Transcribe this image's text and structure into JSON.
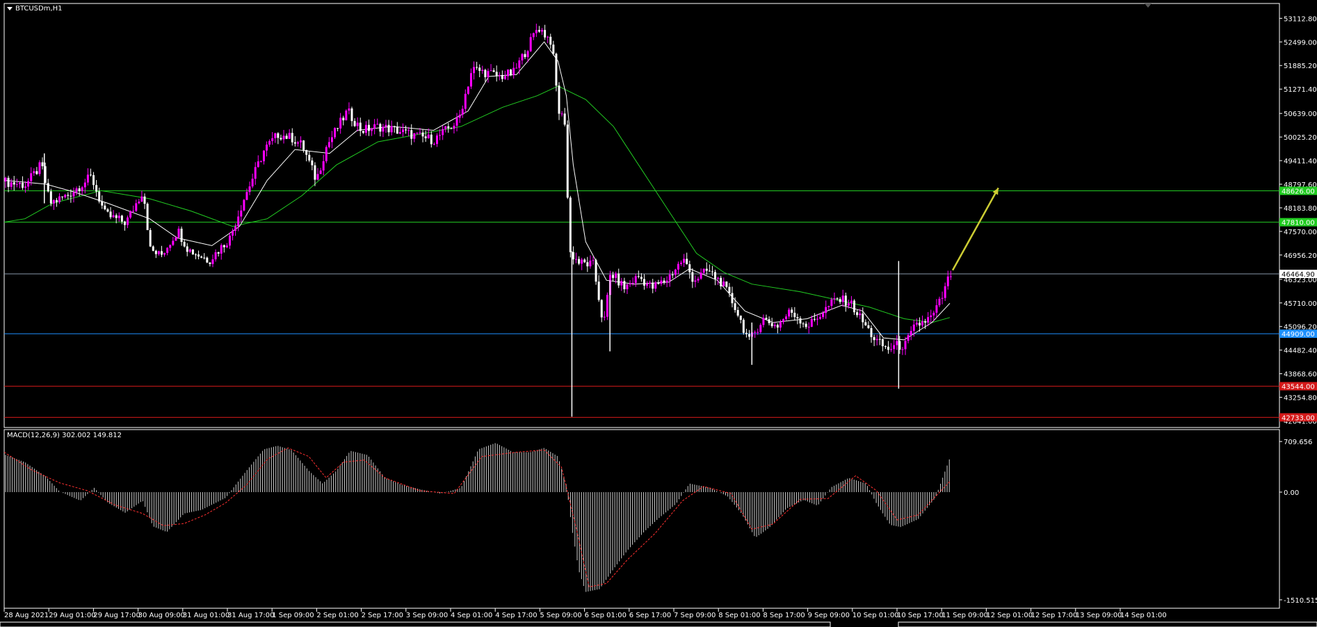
{
  "window": {
    "symbol_title": "BTCUSDm,H1",
    "colors": {
      "background": "#000000",
      "foreground": "#ffffff",
      "bull_candle": "#ff00ff",
      "bear_candle": "#ffffff",
      "ma_fast": "#ffffff",
      "ma_slow": "#22cc22",
      "macd_hist": "#cccccc",
      "macd_signal": "#ff3030",
      "arrow": "#cccc33"
    }
  },
  "chart_data": [
    {
      "type": "candlestick",
      "title": "BTCUSDm,H1",
      "price_ticks": [
        "53112.80",
        "52499.00",
        "51885.20",
        "51271.40",
        "50639.00",
        "50025.20",
        "49411.40",
        "48797.60",
        "48183.80",
        "47570.00",
        "46956.20",
        "46323.00",
        "45710.00",
        "45096.20",
        "44482.40",
        "43868.60",
        "43254.80",
        "42641.00"
      ],
      "ylim": [
        42560,
        53300
      ],
      "xlim": [
        0,
        1376
      ],
      "time_ticks": [
        "28 Aug 2021",
        "29 Aug 01:00",
        "29 Aug 17:00",
        "30 Aug 09:00",
        "31 Aug 01:00",
        "31 Aug 17:00",
        "1 Sep 09:00",
        "2 Sep 01:00",
        "2 Sep 17:00",
        "3 Sep 09:00",
        "4 Sep 01:00",
        "4 Sep 17:00",
        "5 Sep 09:00",
        "6 Sep 01:00",
        "6 Sep 17:00",
        "7 Sep 09:00",
        "8 Sep 01:00",
        "8 Sep 17:00",
        "9 Sep 09:00",
        "10 Sep 01:00",
        "10 Sep 17:00",
        "11 Sep 09:00",
        "12 Sep 01:00",
        "12 Sep 17:00",
        "13 Sep 09:00",
        "14 Sep 01:00"
      ],
      "price_path": [
        [
          0,
          48870
        ],
        [
          35,
          48780
        ],
        [
          58,
          49300
        ],
        [
          70,
          48300
        ],
        [
          95,
          48500
        ],
        [
          130,
          48990
        ],
        [
          150,
          48000
        ],
        [
          180,
          47800
        ],
        [
          205,
          48650
        ],
        [
          215,
          47100
        ],
        [
          230,
          46930
        ],
        [
          255,
          47600
        ],
        [
          270,
          47100
        ],
        [
          300,
          46820
        ],
        [
          330,
          47400
        ],
        [
          350,
          48400
        ],
        [
          380,
          49700
        ],
        [
          400,
          50100
        ],
        [
          420,
          50000
        ],
        [
          435,
          49800
        ],
        [
          455,
          48900
        ],
        [
          470,
          49800
        ],
        [
          500,
          50700
        ],
        [
          520,
          50200
        ],
        [
          545,
          50300
        ],
        [
          570,
          50200
        ],
        [
          600,
          50050
        ],
        [
          625,
          49950
        ],
        [
          660,
          50450
        ],
        [
          680,
          51800
        ],
        [
          700,
          51700
        ],
        [
          720,
          51600
        ],
        [
          740,
          51700
        ],
        [
          760,
          52350
        ],
        [
          775,
          52900
        ],
        [
          795,
          52500
        ],
        [
          805,
          50700
        ],
        [
          815,
          50400
        ],
        [
          820,
          47050
        ],
        [
          835,
          46750
        ],
        [
          855,
          46700
        ],
        [
          870,
          45100
        ],
        [
          880,
          46500
        ],
        [
          900,
          46100
        ],
        [
          920,
          46400
        ],
        [
          940,
          46100
        ],
        [
          960,
          46300
        ],
        [
          985,
          46850
        ],
        [
          1000,
          46300
        ],
        [
          1020,
          46550
        ],
        [
          1040,
          46250
        ],
        [
          1060,
          45600
        ],
        [
          1080,
          44700
        ],
        [
          1100,
          45300
        ],
        [
          1120,
          45100
        ],
        [
          1140,
          45500
        ],
        [
          1165,
          45100
        ],
        [
          1185,
          45450
        ],
        [
          1205,
          45800
        ],
        [
          1225,
          45750
        ],
        [
          1245,
          45200
        ],
        [
          1262,
          44750
        ],
        [
          1280,
          44500
        ],
        [
          1292,
          44600
        ],
        [
          1305,
          44600
        ],
        [
          1320,
          45100
        ],
        [
          1345,
          45350
        ],
        [
          1360,
          45900
        ],
        [
          1370,
          46450
        ]
      ],
      "spikes": [
        {
          "x": 58,
          "high": 49600,
          "low": 48300
        },
        {
          "x": 820,
          "high": 47050,
          "low": 42750
        },
        {
          "x": 875,
          "high": 46300,
          "low": 44450
        },
        {
          "x": 1080,
          "high": 45200,
          "low": 44100
        },
        {
          "x": 1292,
          "high": 46800,
          "low": 43480
        }
      ],
      "ma_fast_path": [
        [
          0,
          48900
        ],
        [
          60,
          48800
        ],
        [
          100,
          48600
        ],
        [
          150,
          48300
        ],
        [
          210,
          47900
        ],
        [
          250,
          47400
        ],
        [
          300,
          47200
        ],
        [
          340,
          47700
        ],
        [
          380,
          48900
        ],
        [
          420,
          49700
        ],
        [
          470,
          49600
        ],
        [
          510,
          50200
        ],
        [
          560,
          50300
        ],
        [
          620,
          50200
        ],
        [
          670,
          50700
        ],
        [
          700,
          51600
        ],
        [
          740,
          51650
        ],
        [
          780,
          52500
        ],
        [
          800,
          52000
        ],
        [
          812,
          51100
        ],
        [
          822,
          49300
        ],
        [
          840,
          47300
        ],
        [
          870,
          46300
        ],
        [
          910,
          46200
        ],
        [
          960,
          46250
        ],
        [
          990,
          46600
        ],
        [
          1030,
          46300
        ],
        [
          1070,
          45500
        ],
        [
          1110,
          45200
        ],
        [
          1160,
          45300
        ],
        [
          1210,
          45650
        ],
        [
          1240,
          45500
        ],
        [
          1270,
          44800
        ],
        [
          1300,
          44750
        ],
        [
          1340,
          45200
        ],
        [
          1366,
          45700
        ]
      ],
      "ma_slow_path": [
        [
          0,
          47810
        ],
        [
          30,
          47900
        ],
        [
          70,
          48300
        ],
        [
          140,
          48630
        ],
        [
          210,
          48420
        ],
        [
          270,
          48100
        ],
        [
          330,
          47700
        ],
        [
          380,
          47900
        ],
        [
          430,
          48500
        ],
        [
          480,
          49300
        ],
        [
          540,
          49900
        ],
        [
          600,
          50100
        ],
        [
          660,
          50300
        ],
        [
          720,
          50800
        ],
        [
          770,
          51100
        ],
        [
          800,
          51350
        ],
        [
          840,
          51000
        ],
        [
          880,
          50300
        ],
        [
          920,
          49200
        ],
        [
          960,
          48100
        ],
        [
          1000,
          47000
        ],
        [
          1040,
          46500
        ],
        [
          1080,
          46200
        ],
        [
          1150,
          46000
        ],
        [
          1200,
          45800
        ],
        [
          1250,
          45600
        ],
        [
          1300,
          45300
        ],
        [
          1340,
          45200
        ],
        [
          1366,
          45330
        ]
      ],
      "levels": [
        {
          "price": 48626.0,
          "label": "48626.00",
          "color": "#22cc22",
          "label_bg": "#22cc22",
          "label_fg": "#ffffff"
        },
        {
          "price": 47810.0,
          "label": "47810.00",
          "color": "#22cc22",
          "label_bg": "#22cc22",
          "label_fg": "#ffffff"
        },
        {
          "price": 46464.9,
          "label": "46464.90",
          "color": "#8899aa",
          "label_bg": "#ffffff",
          "label_fg": "#000000"
        },
        {
          "price": 44909.0,
          "label": "44909.00",
          "color": "#1e90ff",
          "label_bg": "#1e90ff",
          "label_fg": "#ffffff"
        },
        {
          "price": 43544.0,
          "label": "43544.00",
          "color": "#d41a1a",
          "label_bg": "#d41a1a",
          "label_fg": "#ffffff"
        },
        {
          "price": 42733.0,
          "label": "42733.00",
          "color": "#d41a1a",
          "label_bg": "#d41a1a",
          "label_fg": "#ffffff"
        }
      ],
      "arrow": {
        "from": [
          1370,
          46560
        ],
        "to": [
          1436,
          48700
        ]
      }
    },
    {
      "type": "histogram",
      "title": "MACD(12,26,9) 302.002 149.812",
      "ticks": [
        "709.656",
        "0.00",
        "-1510.515"
      ],
      "tick_values": [
        709.656,
        0,
        -1510.515
      ],
      "ylim": [
        -1560,
        760
      ],
      "macd_path": [
        [
          0,
          530
        ],
        [
          30,
          420
        ],
        [
          60,
          220
        ],
        [
          80,
          10
        ],
        [
          110,
          -120
        ],
        [
          130,
          60
        ],
        [
          150,
          -150
        ],
        [
          175,
          -290
        ],
        [
          200,
          -120
        ],
        [
          215,
          -480
        ],
        [
          235,
          -560
        ],
        [
          260,
          -300
        ],
        [
          285,
          -250
        ],
        [
          320,
          -80
        ],
        [
          350,
          300
        ],
        [
          375,
          600
        ],
        [
          395,
          650
        ],
        [
          415,
          590
        ],
        [
          440,
          300
        ],
        [
          460,
          120
        ],
        [
          480,
          300
        ],
        [
          500,
          580
        ],
        [
          525,
          520
        ],
        [
          550,
          200
        ],
        [
          575,
          100
        ],
        [
          605,
          30
        ],
        [
          630,
          -20
        ],
        [
          660,
          60
        ],
        [
          685,
          600
        ],
        [
          710,
          690
        ],
        [
          735,
          560
        ],
        [
          760,
          560
        ],
        [
          780,
          620
        ],
        [
          800,
          500
        ],
        [
          812,
          100
        ],
        [
          820,
          -500
        ],
        [
          830,
          -1100
        ],
        [
          840,
          -1400
        ],
        [
          860,
          -1360
        ],
        [
          880,
          -1080
        ],
        [
          900,
          -820
        ],
        [
          925,
          -550
        ],
        [
          945,
          -370
        ],
        [
          970,
          -170
        ],
        [
          990,
          120
        ],
        [
          1020,
          60
        ],
        [
          1045,
          -60
        ],
        [
          1065,
          -300
        ],
        [
          1085,
          -640
        ],
        [
          1105,
          -500
        ],
        [
          1130,
          -230
        ],
        [
          1155,
          -110
        ],
        [
          1175,
          -190
        ],
        [
          1195,
          70
        ],
        [
          1220,
          200
        ],
        [
          1245,
          120
        ],
        [
          1260,
          -160
        ],
        [
          1280,
          -460
        ],
        [
          1295,
          -490
        ],
        [
          1320,
          -380
        ],
        [
          1345,
          -80
        ],
        [
          1366,
          480
        ]
      ],
      "signal_path": [
        [
          0,
          560
        ],
        [
          40,
          310
        ],
        [
          80,
          130
        ],
        [
          120,
          20
        ],
        [
          160,
          -180
        ],
        [
          200,
          -300
        ],
        [
          230,
          -470
        ],
        [
          260,
          -440
        ],
        [
          290,
          -320
        ],
        [
          320,
          -150
        ],
        [
          350,
          100
        ],
        [
          380,
          460
        ],
        [
          410,
          620
        ],
        [
          440,
          500
        ],
        [
          465,
          200
        ],
        [
          490,
          420
        ],
        [
          520,
          450
        ],
        [
          550,
          200
        ],
        [
          600,
          20
        ],
        [
          650,
          -20
        ],
        [
          690,
          500
        ],
        [
          740,
          560
        ],
        [
          780,
          590
        ],
        [
          805,
          350
        ],
        [
          825,
          -450
        ],
        [
          845,
          -1330
        ],
        [
          870,
          -1280
        ],
        [
          900,
          -950
        ],
        [
          940,
          -580
        ],
        [
          980,
          -120
        ],
        [
          1010,
          80
        ],
        [
          1050,
          -20
        ],
        [
          1080,
          -520
        ],
        [
          1110,
          -450
        ],
        [
          1150,
          -100
        ],
        [
          1190,
          -90
        ],
        [
          1230,
          230
        ],
        [
          1260,
          20
        ],
        [
          1290,
          -390
        ],
        [
          1320,
          -320
        ],
        [
          1366,
          150
        ]
      ]
    }
  ]
}
